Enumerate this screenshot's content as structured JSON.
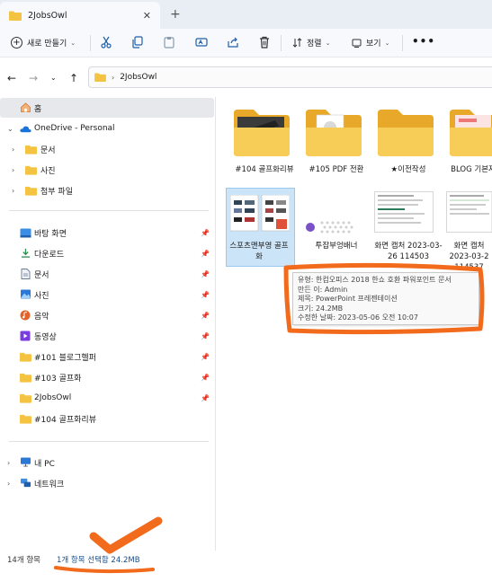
{
  "window": {
    "tab_title": "2JobsOwl",
    "close_symbol": "✕",
    "new_tab_symbol": "+"
  },
  "toolbar": {
    "new_label": "새로 만들기",
    "sort_label": "정렬",
    "view_label": "보기",
    "more_symbol": "•••"
  },
  "address": {
    "path": "2JobsOwl",
    "separator": "›"
  },
  "sidebar": {
    "home": "홈",
    "onedrive": "OneDrive - Personal",
    "onedrive_children": [
      "문서",
      "사진",
      "첨부 파일"
    ],
    "quick_access": [
      {
        "label": "바탕 화면",
        "icon": "desktop-icon",
        "color": "#3a8ee6"
      },
      {
        "label": "다운로드",
        "icon": "download-icon",
        "color": "#2d8a4e"
      },
      {
        "label": "문서",
        "icon": "document-icon",
        "color": "#6b7a8f"
      },
      {
        "label": "사진",
        "icon": "pictures-icon",
        "color": "#2b79d6"
      },
      {
        "label": "음악",
        "icon": "music-icon",
        "color": "#e0642b"
      },
      {
        "label": "동영상",
        "icon": "video-icon",
        "color": "#7a3ce0"
      },
      {
        "label": "#101 블로그헬퍼",
        "icon": "folder-icon",
        "color": "#f5c342"
      },
      {
        "label": "#103 골프화",
        "icon": "folder-icon",
        "color": "#f5c342"
      },
      {
        "label": "2JobsOwl",
        "icon": "folder-icon",
        "color": "#f5c342"
      },
      {
        "label": "#104 골프화리뷰",
        "icon": "folder-icon",
        "color": "#f5c342"
      }
    ],
    "this_pc": "내 PC",
    "network": "네트워크"
  },
  "files": {
    "folders": [
      {
        "name": "#104 골프화리뷰"
      },
      {
        "name": "#105 PDF 전환"
      },
      {
        "name": "★이전작성"
      },
      {
        "name": "BLOG 기본자"
      }
    ],
    "items": [
      {
        "name": "스포츠맨부영 골프화"
      },
      {
        "name": "투잡부엉배너"
      },
      {
        "name": "화면 캡처 2023-03-26 114503"
      },
      {
        "name": "화면 캡처 2023-03-2 114537"
      }
    ]
  },
  "tooltip": {
    "type": "유형: 한컴오피스 2018 한쇼 호환 파워포인트 문서",
    "author": "만든 이: Admin",
    "title": "제목: PowerPoint 프레젠테이션",
    "size": "크기: 24.2MB",
    "modified": "수정한 날짜: 2023-05-06 오전 10:07"
  },
  "status": {
    "count": "14개 항목",
    "selection": "1개 항목 선택함 24.2MB"
  },
  "colors": {
    "accent": "#0067c0",
    "folder": "#f5c342",
    "annotation": "#f26a1b"
  }
}
